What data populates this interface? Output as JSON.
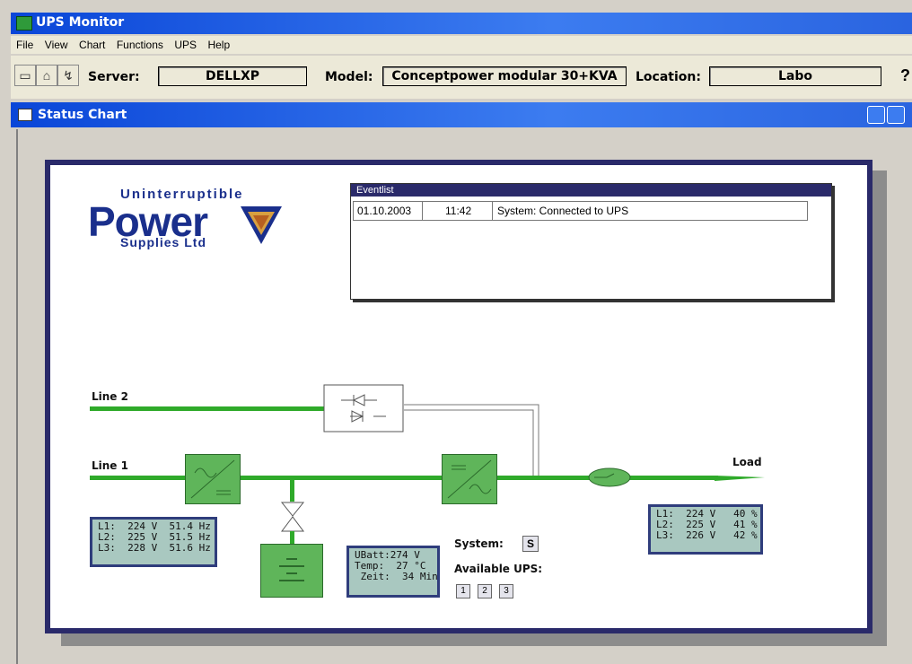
{
  "window": {
    "title": "UPS Monitor"
  },
  "menu": [
    "File",
    "View",
    "Chart",
    "Functions",
    "UPS",
    "Help"
  ],
  "toolbar": {
    "server_label": "Server:",
    "server_value": "DELLXP",
    "model_label": "Model:",
    "model_value": "Conceptpower modular 30+KVA",
    "location_label": "Location:",
    "location_value": "Labo",
    "help_glyph": "?"
  },
  "subwindow": {
    "title": "Status Chart"
  },
  "logo": {
    "line1": "Uninterruptible",
    "line2": "Power",
    "line3": "Supplies Ltd"
  },
  "eventlist": {
    "title": "Eventlist",
    "rows": [
      {
        "date": "01.10.2003",
        "time": "11:42",
        "message": "System: Connected to UPS"
      }
    ]
  },
  "diagram": {
    "line2_label": "Line 2",
    "line1_label": "Line 1",
    "load_label": "Load",
    "input_values": "L1:  224 V  51.4 Hz\nL2:  225 V  51.5 Hz\nL3:  228 V  51.6 Hz",
    "battery_values": "UBatt:274 V\nTemp:  27 °C\n Zeit:  34 Min",
    "output_values": "L1:  224 V   40 %\nL2:  225 V   41 %\nL3:  226 V   42 %",
    "system_label": "System:",
    "system_button": "S",
    "available_label": "Available UPS:",
    "ups_buttons": [
      "1",
      "2",
      "3"
    ]
  },
  "colors": {
    "accent": "#0a46d8",
    "line_green": "#2faa2a",
    "box_green": "#5fb55a",
    "panel_border": "#2a2a6a"
  }
}
